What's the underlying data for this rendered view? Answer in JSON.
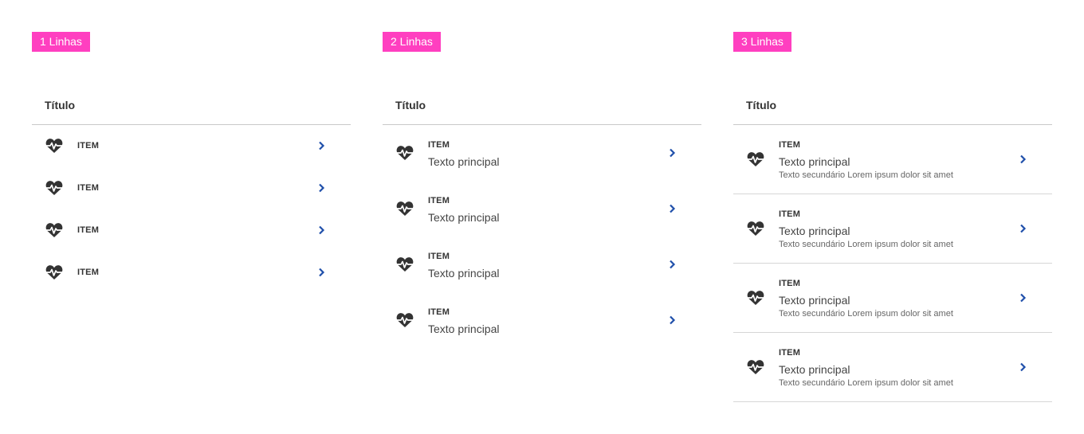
{
  "accent_color": "#ff3fc0",
  "link_color": "#1f4faa",
  "icons": {
    "item_icon": "heartbeat-icon",
    "row_action": "chevron-right-icon"
  },
  "columns": [
    {
      "tag": "1 Linhas",
      "title": "Título",
      "items": [
        {
          "label": "ITEM"
        },
        {
          "label": "ITEM"
        },
        {
          "label": "ITEM"
        },
        {
          "label": "ITEM"
        }
      ]
    },
    {
      "tag": "2 Linhas",
      "title": "Título",
      "items": [
        {
          "label": "ITEM",
          "primary": "Texto principal"
        },
        {
          "label": "ITEM",
          "primary": "Texto principal"
        },
        {
          "label": "ITEM",
          "primary": "Texto principal"
        },
        {
          "label": "ITEM",
          "primary": "Texto principal"
        }
      ]
    },
    {
      "tag": "3 Linhas",
      "title": "Título",
      "items": [
        {
          "label": "ITEM",
          "primary": "Texto principal",
          "secondary": "Texto secundário Lorem ipsum dolor sit amet"
        },
        {
          "label": "ITEM",
          "primary": "Texto principal",
          "secondary": "Texto secundário Lorem ipsum dolor sit amet"
        },
        {
          "label": "ITEM",
          "primary": "Texto principal",
          "secondary": "Texto secundário Lorem ipsum dolor sit amet"
        },
        {
          "label": "ITEM",
          "primary": "Texto principal",
          "secondary": "Texto secundário Lorem ipsum dolor sit amet"
        }
      ]
    }
  ]
}
